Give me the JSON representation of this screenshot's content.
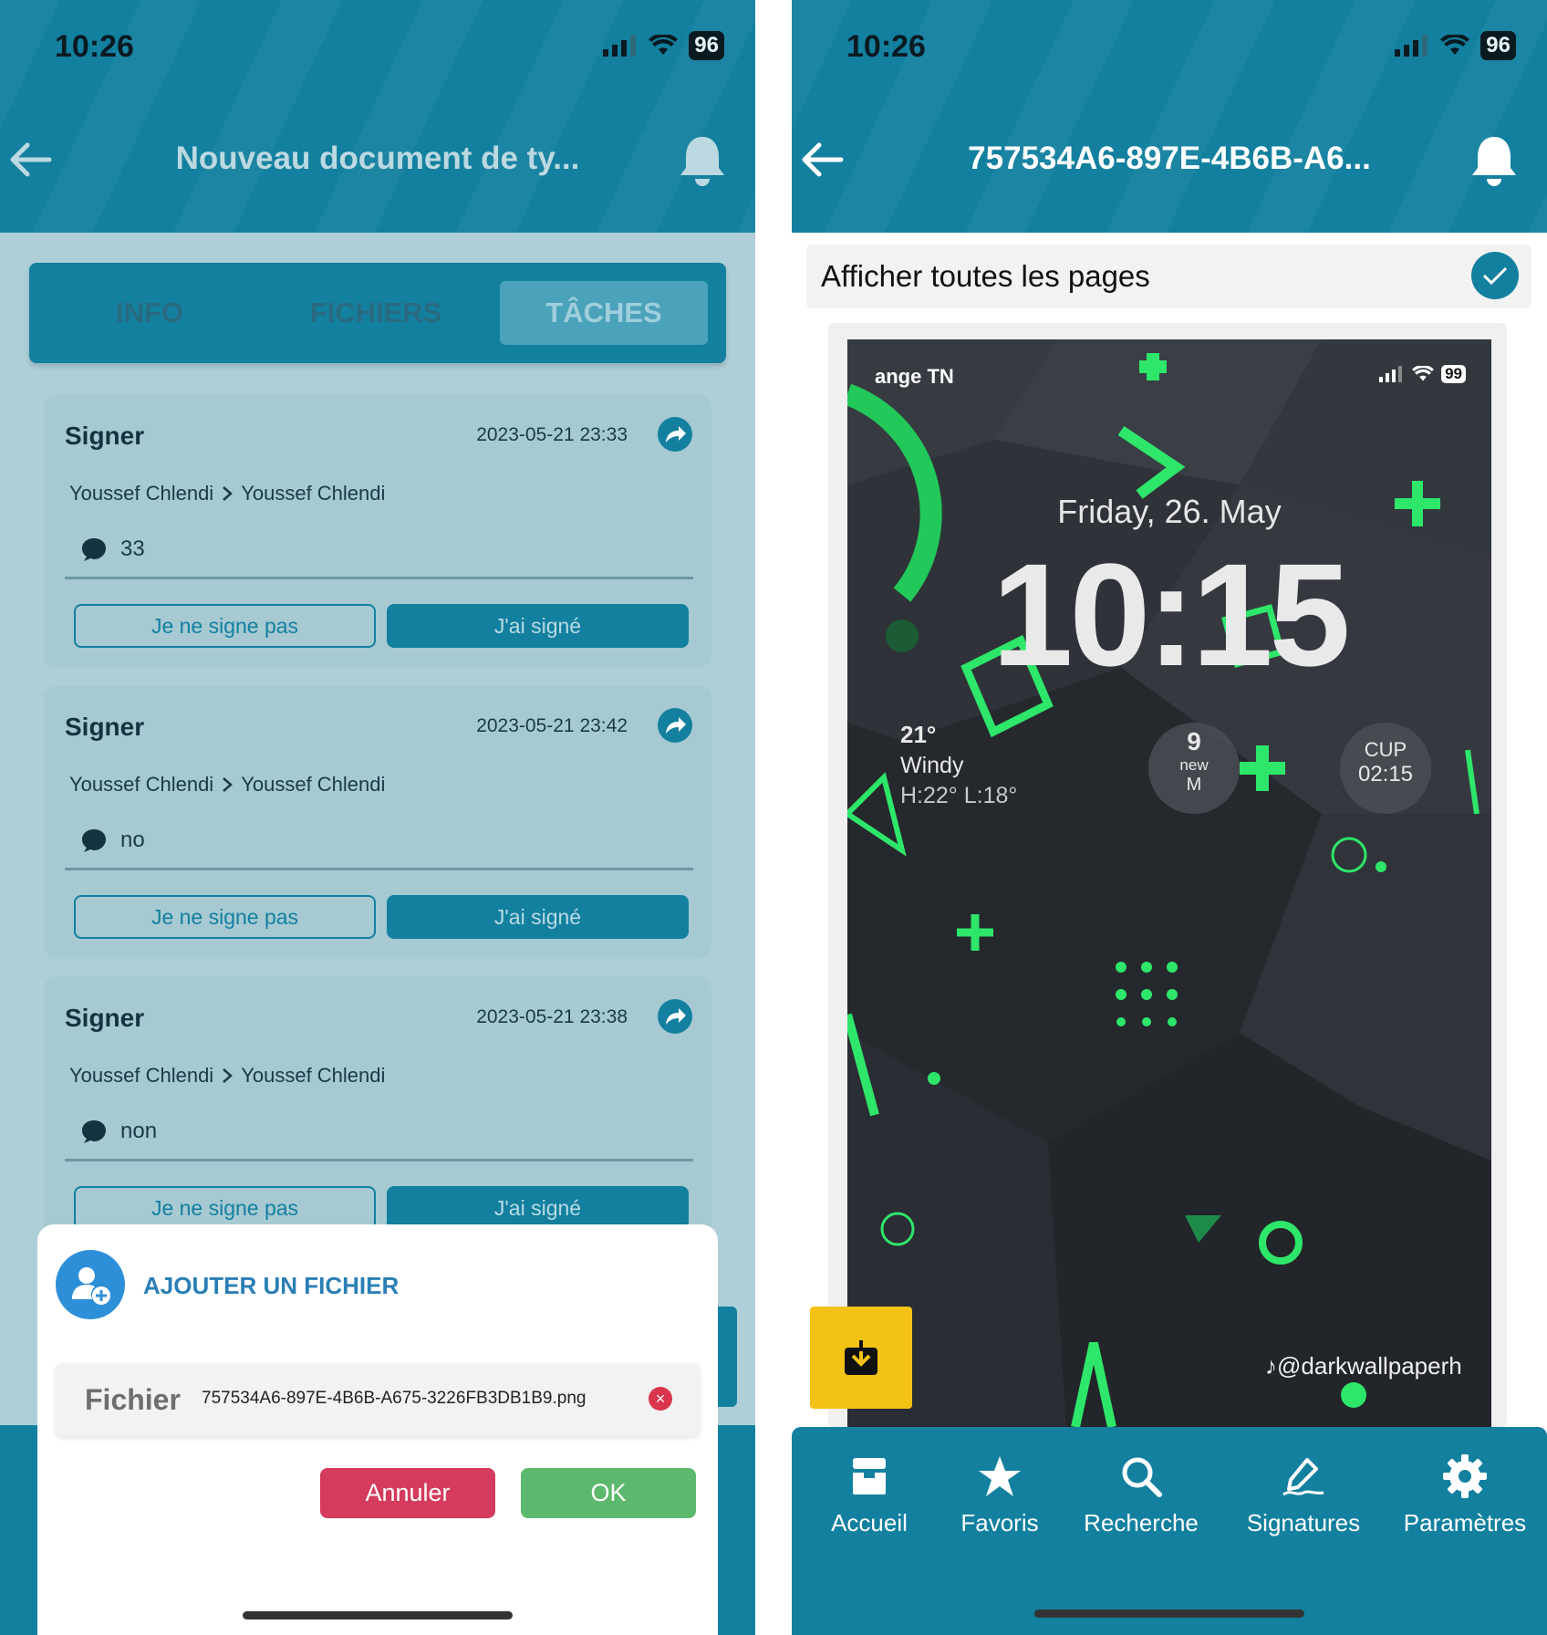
{
  "left_screen": {
    "status_bar": {
      "time": "10:26",
      "battery": "96"
    },
    "header": {
      "title": "Nouveau document de ty..."
    },
    "tabs": [
      {
        "label": "INFO",
        "active": false
      },
      {
        "label": "FICHIERS",
        "active": false
      },
      {
        "label": "TÂCHES",
        "active": true
      }
    ],
    "tasks": [
      {
        "title": "Signer",
        "date": "2023-05-21 23:33",
        "from": "Youssef Chlendi",
        "to": "Youssef Chlendi",
        "comment": "33",
        "decline_label": "Je ne signe pas",
        "accept_label": "J'ai signé"
      },
      {
        "title": "Signer",
        "date": "2023-05-21 23:42",
        "from": "Youssef Chlendi",
        "to": "Youssef Chlendi",
        "comment": "no",
        "decline_label": "Je ne signe pas",
        "accept_label": "J'ai signé"
      },
      {
        "title": "Signer",
        "date": "2023-05-21 23:38",
        "from": "Youssef Chlendi",
        "to": "Youssef Chlendi",
        "comment": "non",
        "decline_label": "Je ne signe pas",
        "accept_label": "J'ai signé"
      }
    ],
    "modal": {
      "title": "AJOUTER UN FICHIER",
      "file_label": "Fichier",
      "file_name": "757534A6-897E-4B6B-A675-3226FB3DB1B9.png",
      "cancel_label": "Annuler",
      "ok_label": "OK"
    }
  },
  "right_screen": {
    "status_bar": {
      "time": "10:26",
      "battery": "96"
    },
    "header": {
      "title": "757534A6-897E-4B6B-A6..."
    },
    "show_all_pages": {
      "label": "Afficher toutes les pages",
      "checked": true
    },
    "preview": {
      "carrier": "ange TN",
      "battery": "99",
      "date": "Friday, 26. May",
      "clock": "10:15",
      "weather_temp": "21°",
      "weather_desc": "Windy",
      "weather_range": "H:22° L:18°",
      "mail_count": "9",
      "mail_label": "new",
      "cup_label": "CUP",
      "cup_time": "02:15",
      "watermark": "@darkwallpaperh"
    },
    "tabbar": [
      {
        "label": "Accueil",
        "icon": "inbox-icon"
      },
      {
        "label": "Favoris",
        "icon": "star-icon"
      },
      {
        "label": "Recherche",
        "icon": "search-icon"
      },
      {
        "label": "Signatures",
        "icon": "signature-pen-icon"
      },
      {
        "label": "Paramètres",
        "icon": "gear-icon"
      }
    ]
  },
  "colors": {
    "primary": "#13809f",
    "overlay_bg": "#aecfd8",
    "cancel": "#d43b5c",
    "ok": "#5cb86c",
    "download": "#f4c215",
    "accent_green": "#2ee66a"
  }
}
